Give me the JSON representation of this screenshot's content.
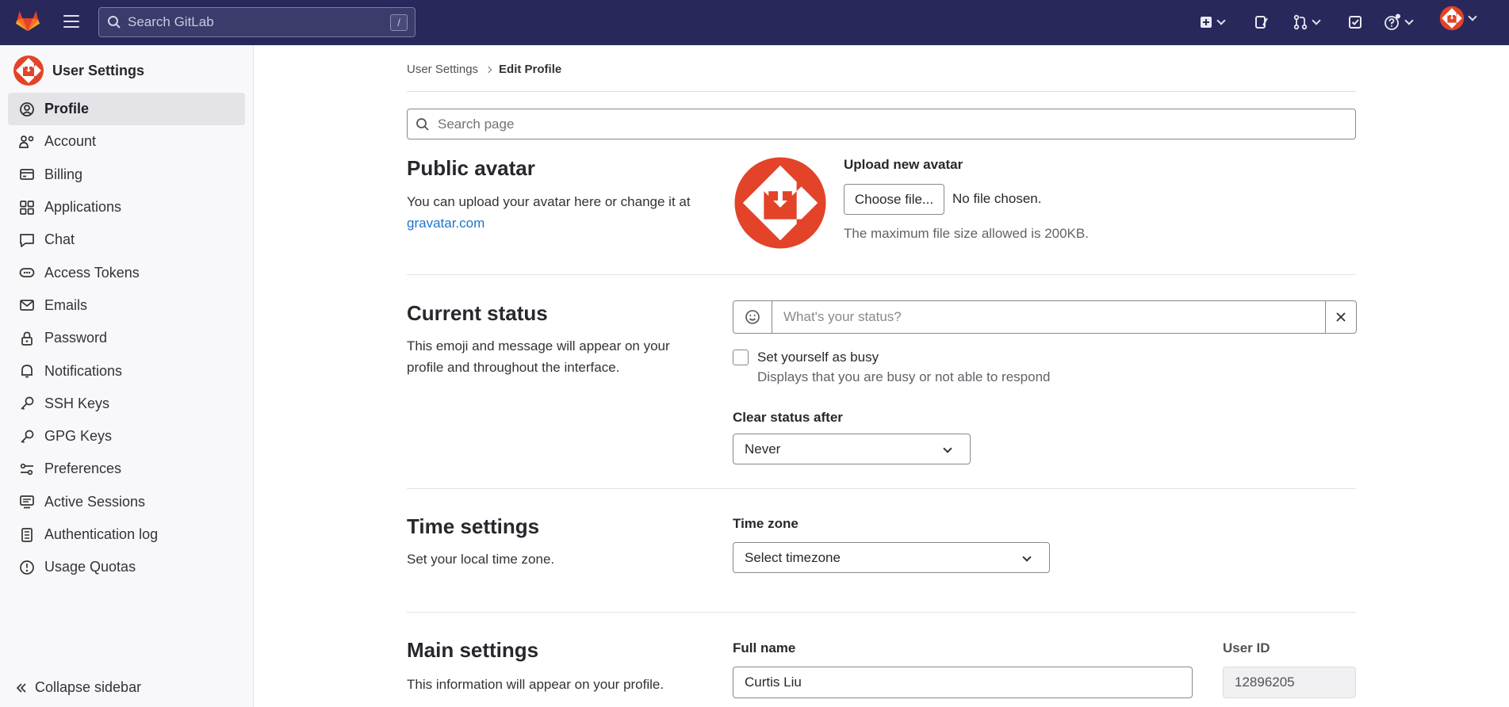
{
  "topbar": {
    "search_placeholder": "Search GitLab",
    "search_shortcut": "/"
  },
  "sidebar": {
    "title": "User Settings",
    "items": [
      {
        "label": "Profile",
        "icon": "profile-icon"
      },
      {
        "label": "Account",
        "icon": "account-icon"
      },
      {
        "label": "Billing",
        "icon": "billing-icon"
      },
      {
        "label": "Applications",
        "icon": "applications-icon"
      },
      {
        "label": "Chat",
        "icon": "chat-icon"
      },
      {
        "label": "Access Tokens",
        "icon": "token-icon"
      },
      {
        "label": "Emails",
        "icon": "mail-icon"
      },
      {
        "label": "Password",
        "icon": "lock-icon"
      },
      {
        "label": "Notifications",
        "icon": "bell-icon"
      },
      {
        "label": "SSH Keys",
        "icon": "key-icon"
      },
      {
        "label": "GPG Keys",
        "icon": "key-icon"
      },
      {
        "label": "Preferences",
        "icon": "preferences-icon"
      },
      {
        "label": "Active Sessions",
        "icon": "monitor-icon"
      },
      {
        "label": "Authentication log",
        "icon": "log-icon"
      },
      {
        "label": "Usage Quotas",
        "icon": "quota-icon"
      }
    ],
    "collapse_label": "Collapse sidebar"
  },
  "breadcrumb": {
    "parent": "User Settings",
    "current": "Edit Profile"
  },
  "page_search_placeholder": "Search page",
  "avatar_section": {
    "title": "Public avatar",
    "desc": "You can upload your avatar here or change it at",
    "link": "gravatar.com",
    "upload_label": "Upload new avatar",
    "choose_button": "Choose file...",
    "no_file": "No file chosen.",
    "help": "The maximum file size allowed is 200KB."
  },
  "status_section": {
    "title": "Current status",
    "desc": "This emoji and message will appear on your profile and throughout the interface.",
    "placeholder": "What's your status?",
    "busy_label": "Set yourself as busy",
    "busy_help": "Displays that you are busy or not able to respond",
    "clear_label": "Clear status after",
    "clear_value": "Never"
  },
  "time_section": {
    "title": "Time settings",
    "desc": "Set your local time zone.",
    "tz_label": "Time zone",
    "tz_value": "Select timezone"
  },
  "main_section": {
    "title": "Main settings",
    "desc": "This information will appear on your profile.",
    "full_name_label": "Full name",
    "full_name_value": "Curtis Liu",
    "user_id_label": "User ID",
    "user_id_value": "12896205"
  },
  "colors": {
    "topbar": "#28285b",
    "avatar": "#e24329",
    "link": "#1f75cb"
  }
}
